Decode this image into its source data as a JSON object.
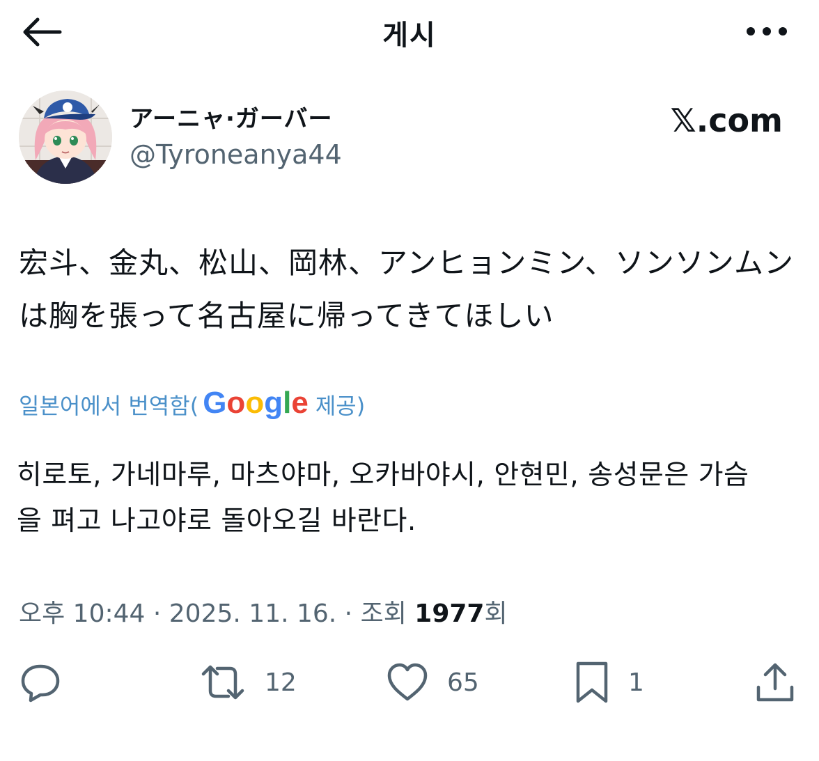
{
  "header": {
    "title": "게시"
  },
  "author": {
    "name": "アーニャ·ガーバー",
    "handle": "@Tyroneanya44"
  },
  "branding": {
    "site": "𝕏.com"
  },
  "tweet": {
    "lines": [
      "宏斗、金丸、松山、岡林、アンヒョンミン、ソンソンムン",
      "は胸を張って名古屋に帰ってきてほしい"
    ]
  },
  "translation": {
    "label": "일본어에서 번역함(",
    "provider": "Google",
    "suffix": "제공)",
    "lines": [
      "히로토, 가네마루, 마츠야마, 오카바야시, 안현민, 송성문은 가슴",
      "을 펴고 나고야로 돌아오길 바란다."
    ]
  },
  "meta": {
    "time": "오후 10:44",
    "sep1": " · ",
    "date": "2025. 11. 16.",
    "sep2": " · ",
    "views_label": "조회 ",
    "views_count": "1977",
    "views_suffix": "회"
  },
  "actions": {
    "reply": {
      "icon": "reply-icon",
      "count": ""
    },
    "repost": {
      "icon": "repost-icon",
      "count": "12"
    },
    "like": {
      "icon": "heart-icon",
      "count": "65"
    },
    "bookmark": {
      "icon": "bookmark-icon",
      "count": "1"
    },
    "share": {
      "icon": "share-icon",
      "count": ""
    }
  },
  "colors": {
    "text": "#0f1419",
    "secondary": "#536471",
    "link": "#4a90c9"
  }
}
